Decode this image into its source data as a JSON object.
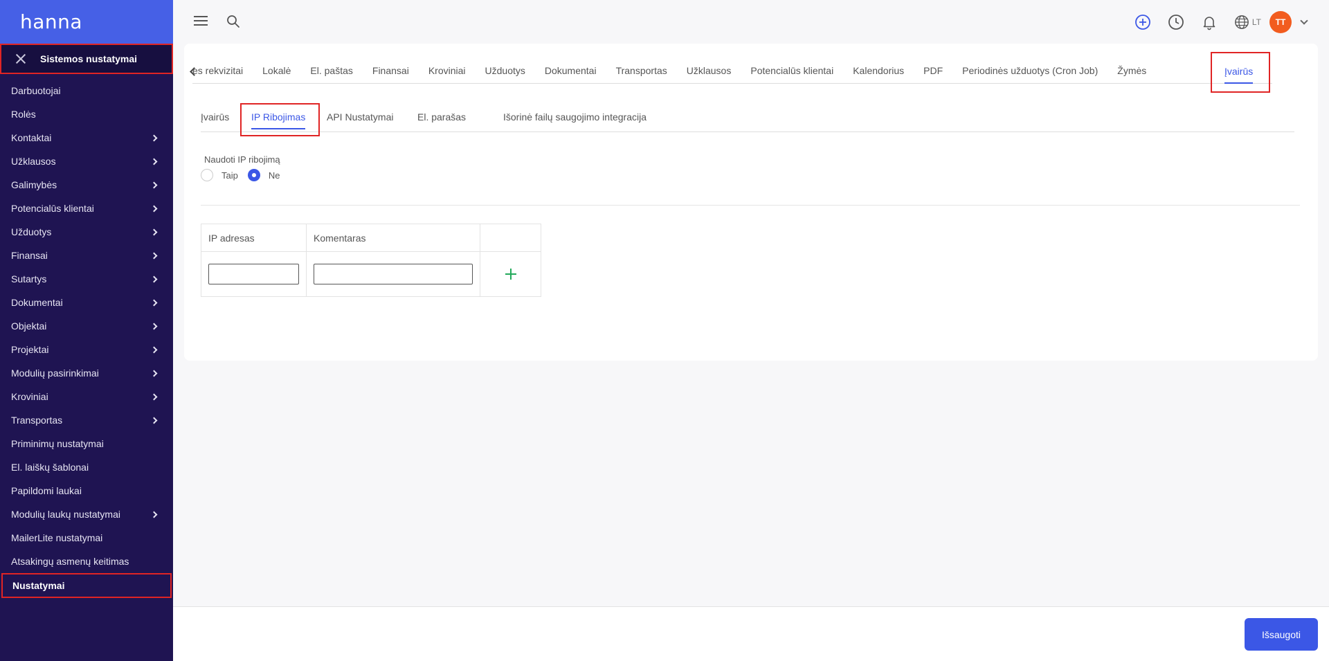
{
  "sidebar": {
    "brand": "hanna",
    "section_title": "Sistemos nustatymai",
    "items": [
      {
        "label": "Darbuotojai",
        "chevron": false
      },
      {
        "label": "Rolės",
        "chevron": false
      },
      {
        "label": "Kontaktai",
        "chevron": true
      },
      {
        "label": "Užklausos",
        "chevron": true
      },
      {
        "label": "Galimybės",
        "chevron": true
      },
      {
        "label": "Potencialūs klientai",
        "chevron": true
      },
      {
        "label": "Užduotys",
        "chevron": true
      },
      {
        "label": "Finansai",
        "chevron": true
      },
      {
        "label": "Sutartys",
        "chevron": true
      },
      {
        "label": "Dokumentai",
        "chevron": true
      },
      {
        "label": "Objektai",
        "chevron": true
      },
      {
        "label": "Projektai",
        "chevron": true
      },
      {
        "label": "Modulių pasirinkimai",
        "chevron": true
      },
      {
        "label": "Kroviniai",
        "chevron": true
      },
      {
        "label": "Transportas",
        "chevron": true
      },
      {
        "label": "Priminimų nustatymai",
        "chevron": false
      },
      {
        "label": "El. laiškų šablonai",
        "chevron": false
      },
      {
        "label": "Papildomi laukai",
        "chevron": false
      },
      {
        "label": "Modulių laukų nustatymai",
        "chevron": true
      },
      {
        "label": "MailerLite nustatymai",
        "chevron": false
      },
      {
        "label": "Atsakingų asmenų keitimas",
        "chevron": false
      },
      {
        "label": "Nustatymai",
        "chevron": false,
        "active": true
      }
    ]
  },
  "topbar": {
    "language": "LT",
    "avatar_initials": "TT"
  },
  "main_tabs": {
    "items": [
      "es rekvizitai",
      "Lokalė",
      "El. paštas",
      "Finansai",
      "Kroviniai",
      "Užduotys",
      "Dokumentai",
      "Transportas",
      "Užklausos",
      "Potencialūs klientai",
      "Kalendorius",
      "PDF",
      "Periodinės užduotys (Cron Job)",
      "Žymės"
    ],
    "active": "Įvairūs"
  },
  "sub_tabs": {
    "items": [
      "Įvairūs",
      "API Nustatymai",
      "El. parašas",
      "Išorinė failų saugojimo integracija"
    ],
    "active": "IP Ribojimas"
  },
  "ip_restriction": {
    "label": "Naudoti IP ribojimą",
    "option_yes": "Taip",
    "option_no": "Ne",
    "selected": "Ne"
  },
  "ip_table": {
    "headers": [
      "IP adresas",
      "Komentaras",
      ""
    ],
    "ip_value": "",
    "comment_value": ""
  },
  "footer": {
    "save_label": "Išsaugoti"
  },
  "colors": {
    "accent": "#3b57e6",
    "sidebar_bg": "#1f1452",
    "brand_bg": "#4660e6",
    "highlight_border": "#e02424",
    "plus_green": "#22a95a",
    "avatar_bg": "#f25c1f"
  }
}
